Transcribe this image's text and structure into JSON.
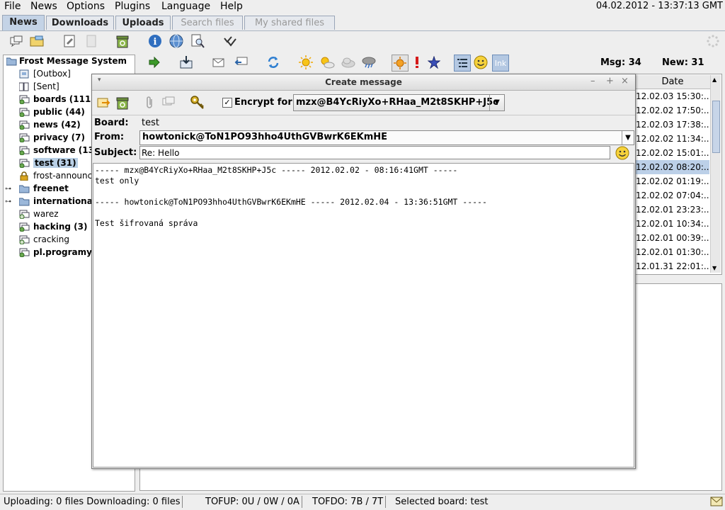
{
  "menu": [
    "File",
    "News",
    "Options",
    "Plugins",
    "Language",
    "Help"
  ],
  "datetime": "04.02.2012 - 13:37:13 GMT",
  "tabs": [
    {
      "label": "News",
      "state": "active"
    },
    {
      "label": "Downloads",
      "state": "normal"
    },
    {
      "label": "Uploads",
      "state": "normal"
    },
    {
      "label": "Search files",
      "state": "disabled"
    },
    {
      "label": "My shared files",
      "state": "disabled"
    }
  ],
  "tree": {
    "root": "Frost Message System",
    "items": [
      {
        "label": "[Outbox]",
        "bold": false
      },
      {
        "label": "[Sent]",
        "bold": false
      },
      {
        "label": "boards (111)",
        "bold": true
      },
      {
        "label": "public (44)",
        "bold": true
      },
      {
        "label": "news (42)",
        "bold": true
      },
      {
        "label": "privacy (7)",
        "bold": true
      },
      {
        "label": "software (13",
        "bold": true
      },
      {
        "label": "test (31)",
        "bold": true,
        "selected": true
      },
      {
        "label": "frost-announc",
        "bold": false
      },
      {
        "label": "freenet",
        "bold": true,
        "folder": true
      },
      {
        "label": "internationa",
        "bold": true,
        "folder": true
      },
      {
        "label": "warez",
        "bold": false
      },
      {
        "label": "hacking (3)",
        "bold": true
      },
      {
        "label": "cracking",
        "bold": false
      },
      {
        "label": "pl.programy",
        "bold": true
      }
    ]
  },
  "counters": {
    "msg_label": "Msg: 34",
    "new_label": "New: 31"
  },
  "list": {
    "date_header": "Date",
    "dates": [
      "12.02.03 15:30:...",
      "12.02.02 17:50:...",
      "12.02.03 17:38:...",
      "12.02.02 11:34:...",
      "12.02.02 15:01:...",
      "12.02.02 08:20:...",
      "12.02.02 01:19:...",
      "12.02.02 07:04:...",
      "12.02.01 23:23:...",
      "12.02.01 10:34:...",
      "12.02.01 00:39:...",
      "12.02.01 01:30:...",
      "12.01.31 22:01:..."
    ],
    "selected_index": 5
  },
  "dialog": {
    "title": "Create message",
    "encrypt_label": "Encrypt for",
    "encrypt_checked": true,
    "encrypt_recipient": "mzx@B4YcRiyXo+RHaa_M2t8SKHP+J5c",
    "board_label": "Board:",
    "board_value": "test",
    "from_label": "From:",
    "from_value": "howtonick@ToN1PO93hho4UthGVBwrK6EKmHE",
    "subject_label": "Subject:",
    "subject_value": "Re: Hello",
    "body_lines": [
      "----- mzx@B4YcRiyXo+RHaa_M2t8SKHP+J5c ----- 2012.02.02 - 08:16:41GMT -----",
      "test only",
      "",
      "----- howtonick@ToN1PO93hho4UthGVBwrK6EKmHE ----- 2012.02.04 - 13:36:51GMT -----",
      "",
      "Test šifrovaná správa"
    ]
  },
  "status": {
    "transfer": "Uploading: 0 files  Downloading: 0 files",
    "tofup": "TOFUP: 0U / 0W / 0A",
    "tofdo": "TOFDO: 7B / 7T",
    "selected_board": "Selected board: test"
  },
  "colors": {
    "selection": "#bcd0e8",
    "active_tab": "#c4d3e6"
  }
}
